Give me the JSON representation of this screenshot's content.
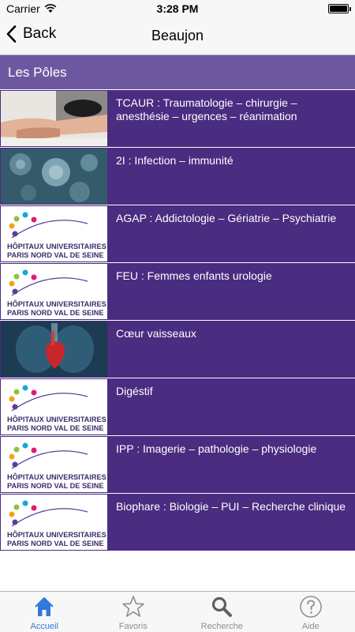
{
  "status": {
    "carrier": "Carrier",
    "time": "3:28 PM"
  },
  "nav": {
    "back_label": "Back",
    "title": "Beaujon"
  },
  "section": {
    "title": "Les Pôles"
  },
  "logo": {
    "line1": "HÔPITAUX UNIVERSITAIRES",
    "line2": "PARIS NORD VAL DE SEINE"
  },
  "items": [
    {
      "label": "TCAUR : Traumatologie – chirurgie – anesthésie – urgences – réanimation",
      "image": "trauma-photo"
    },
    {
      "label": "2I : Infection – immunité",
      "image": "virus-photo"
    },
    {
      "label": "AGAP : Addictologie – Gériatrie – Psychiatrie",
      "image": "hospital-logo"
    },
    {
      "label": "FEU : Femmes enfants urologie",
      "image": "hospital-logo"
    },
    {
      "label": "Cœur vaisseaux",
      "image": "heart-photo"
    },
    {
      "label": "Digéstif",
      "image": "hospital-logo"
    },
    {
      "label": "IPP : Imagerie – pathologie – physiologie",
      "image": "hospital-logo"
    },
    {
      "label": "Biophare : Biologie – PUI – Recherche clinique",
      "image": "hospital-logo"
    }
  ],
  "tabs": [
    {
      "label": "Accueil",
      "icon": "home-icon",
      "active": true
    },
    {
      "label": "Favoris",
      "icon": "star-icon",
      "active": false
    },
    {
      "label": "Recherche",
      "icon": "search-icon",
      "active": false
    },
    {
      "label": "Aide",
      "icon": "help-icon",
      "active": false
    }
  ],
  "colors": {
    "header": "#6d58a0",
    "row": "#4a2c80",
    "tab_active": "#2f7bdc",
    "tab_inactive": "#8e8e93"
  }
}
